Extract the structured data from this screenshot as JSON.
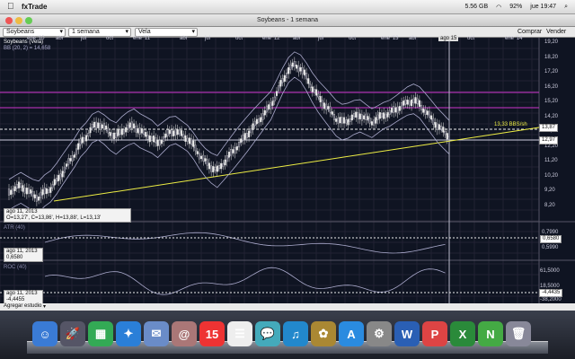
{
  "menubar": {
    "apple": "",
    "app": "fxTrade",
    "sizes": "5.56 GB",
    "battery": "92%",
    "clock": "jue 19:47"
  },
  "window": {
    "title": "Soybeans - 1 semana"
  },
  "toolbar": {
    "instrument": "Soybeans",
    "period": "1 semana",
    "style": "Vela",
    "buy": "Comprar",
    "sell": "Vender"
  },
  "chart": {
    "title": "Soybeans (Vela)",
    "indicator": "BB (20, 2) = 14,658",
    "time_labels": [
      "ene '10",
      "abr",
      "jul",
      "oct",
      "ene '11",
      "abr",
      "jul",
      "oct",
      "ene '12",
      "abr",
      "jul",
      "oct",
      "ene '13",
      "abr",
      "ago 15",
      "oct",
      "ene '14"
    ],
    "price_axis": [
      "19,20",
      "18,20",
      "17,20",
      "16,20",
      "15,20",
      "14,20",
      "13,20",
      "12,20",
      "11,20",
      "10,20",
      "9,20",
      "8,20"
    ],
    "price_current": "13,87",
    "price_line2": "12,97",
    "trend_tag": "13,33 BBS/sh",
    "info_date": "ago 11, 2013",
    "info_ohlc": "O=13,27', C=13,86', H=13,88', L=13,13'"
  },
  "atr": {
    "label": "ATR (40)",
    "axis_top": "0,7990",
    "axis_cur": "0,6580",
    "axis_bot": "0,5990",
    "info_date": "ago 11, 2013",
    "info_value": "0,6580"
  },
  "roc": {
    "label": "ROC (40)",
    "axis_top": "61,5000",
    "axis_mid": "18,5000",
    "axis_cur": "-4,4435",
    "axis_bot": "-38,2000",
    "info_date": "ago 11, 2013",
    "info_value": "-4,4455"
  },
  "status": {
    "add_study": "Agregar estudio"
  },
  "dock": [
    {
      "name": "finder",
      "glyph": "☺",
      "color": "#3a7bd5"
    },
    {
      "name": "launchpad",
      "glyph": "🚀",
      "color": "#556"
    },
    {
      "name": "mission-control",
      "glyph": "▦",
      "color": "#3a5"
    },
    {
      "name": "safari",
      "glyph": "✦",
      "color": "#2a7fd8"
    },
    {
      "name": "mail",
      "glyph": "✉",
      "color": "#6a8cc8"
    },
    {
      "name": "contacts",
      "glyph": "@",
      "color": "#a77"
    },
    {
      "name": "calendar",
      "glyph": "15",
      "color": "#e33"
    },
    {
      "name": "reminders",
      "glyph": "☰",
      "color": "#eee"
    },
    {
      "name": "messages",
      "glyph": "💬",
      "color": "#4ab"
    },
    {
      "name": "itunes",
      "glyph": "♫",
      "color": "#28c"
    },
    {
      "name": "photos",
      "glyph": "✿",
      "color": "#a83"
    },
    {
      "name": "app-store",
      "glyph": "A",
      "color": "#2a8be0"
    },
    {
      "name": "system-preferences",
      "glyph": "⚙",
      "color": "#888"
    },
    {
      "name": "word",
      "glyph": "W",
      "color": "#2a5fb4"
    },
    {
      "name": "powerpoint",
      "glyph": "P",
      "color": "#d44"
    },
    {
      "name": "excel",
      "glyph": "X",
      "color": "#2a8a3a"
    },
    {
      "name": "fxtrade",
      "glyph": "N",
      "color": "#4a4"
    },
    {
      "name": "trash",
      "glyph": "🗑",
      "color": "#889"
    }
  ]
}
